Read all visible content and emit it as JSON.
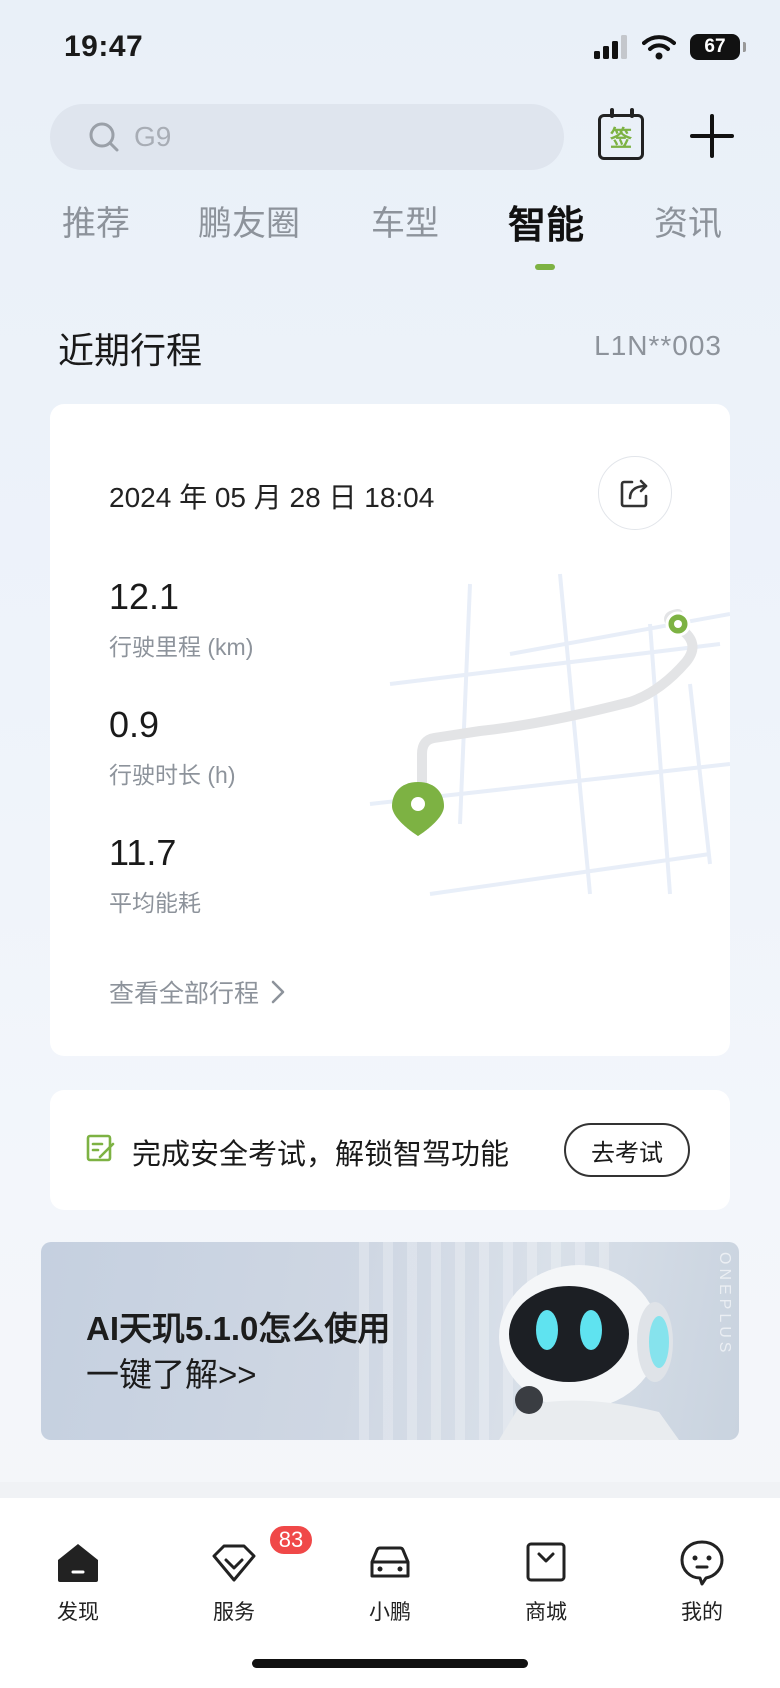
{
  "status_bar": {
    "time": "19:47",
    "battery": "67"
  },
  "search": {
    "placeholder": "G9"
  },
  "header_actions": {
    "sign_in_label": "签"
  },
  "tabs": [
    {
      "label": "推荐",
      "active": false
    },
    {
      "label": "鹏友圈",
      "active": false
    },
    {
      "label": "车型",
      "active": false
    },
    {
      "label": "智能",
      "active": true
    },
    {
      "label": "资讯",
      "active": false
    }
  ],
  "recent_trips": {
    "title": "近期行程",
    "vin": "L1N**003",
    "date": "2024 年 05 月 28 日 18:04",
    "stats": [
      {
        "value": "12.1",
        "label": "行驶里程 (km)"
      },
      {
        "value": "0.9",
        "label": "行驶时长 (h)"
      },
      {
        "value": "11.7",
        "label": "平均能耗"
      }
    ],
    "view_all": "查看全部行程"
  },
  "exam": {
    "text": "完成安全考试，解锁智驾功能",
    "button": "去考试"
  },
  "banner": {
    "title": "AI天玑5.1.0怎么使用",
    "subtitle": "一键了解>>",
    "watermark": "ONEPLUS"
  },
  "bottom_nav": [
    {
      "label": "发现",
      "icon": "home-icon"
    },
    {
      "label": "服务",
      "icon": "service-icon",
      "badge": "83"
    },
    {
      "label": "小鹏",
      "icon": "car-icon"
    },
    {
      "label": "商城",
      "icon": "shop-icon"
    },
    {
      "label": "我的",
      "icon": "profile-icon"
    }
  ],
  "colors": {
    "accent_green": "#7db243",
    "badge_red": "#f04848"
  }
}
